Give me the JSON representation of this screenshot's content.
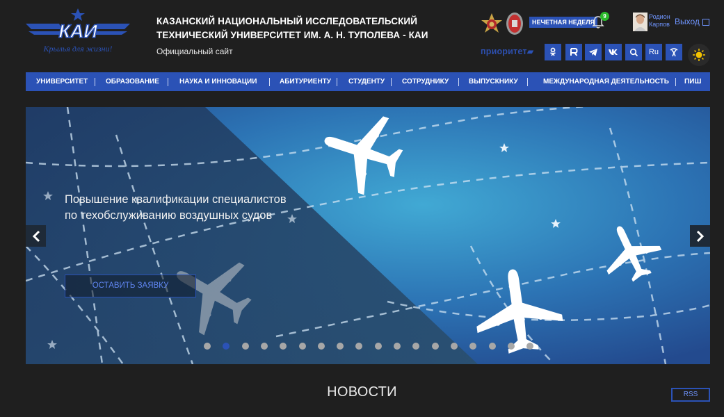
{
  "header": {
    "logo_text": "КАИ",
    "logo_slogan": "Крылья для жизни!",
    "title_line1": "КАЗАНСКИЙ НАЦИОНАЛЬНЫЙ ИССЛЕДОВАТЕЛЬСКИЙ",
    "title_line2": "ТЕХНИЧЕСКИЙ УНИВЕРСИТЕТ ИМ. А. Н. ТУПОЛЕВА - КАИ",
    "subtitle": "Официальный сайт",
    "week_badge": "НЕЧЕТНАЯ НЕДЕЛЯ",
    "notifications_count": "9",
    "user_first_name": "Родион",
    "user_last_name": "Карпов",
    "logout_label": "Выход",
    "prioritet_label": "приоритет",
    "lang_label": "Ru",
    "social_icons": [
      "ok-icon",
      "rutube-icon",
      "telegram-icon",
      "vk-icon",
      "search-icon"
    ],
    "accent": "#2b52b6"
  },
  "nav": {
    "items": [
      "УНИВЕРСИТЕТ",
      "ОБРАЗОВАНИЕ",
      "НАУКА И ИННОВАЦИИ",
      "АБИТУРИЕНТУ",
      "СТУДЕНТУ",
      "СОТРУДНИКУ",
      "ВЫПУСКНИКУ",
      "МЕЖДУНАРОДНАЯ ДЕЯТЕЛЬНОСТЬ",
      "ПИШ"
    ]
  },
  "slider": {
    "caption": "Повышение квалификации специалистов по техобслуживанию воздушных судов",
    "cta_label": "ОСТАВИТЬ ЗАЯВКУ",
    "dot_count": 18,
    "active_dot": 2
  },
  "news": {
    "title": "НОВОСТИ",
    "rss_label": "RSS"
  }
}
